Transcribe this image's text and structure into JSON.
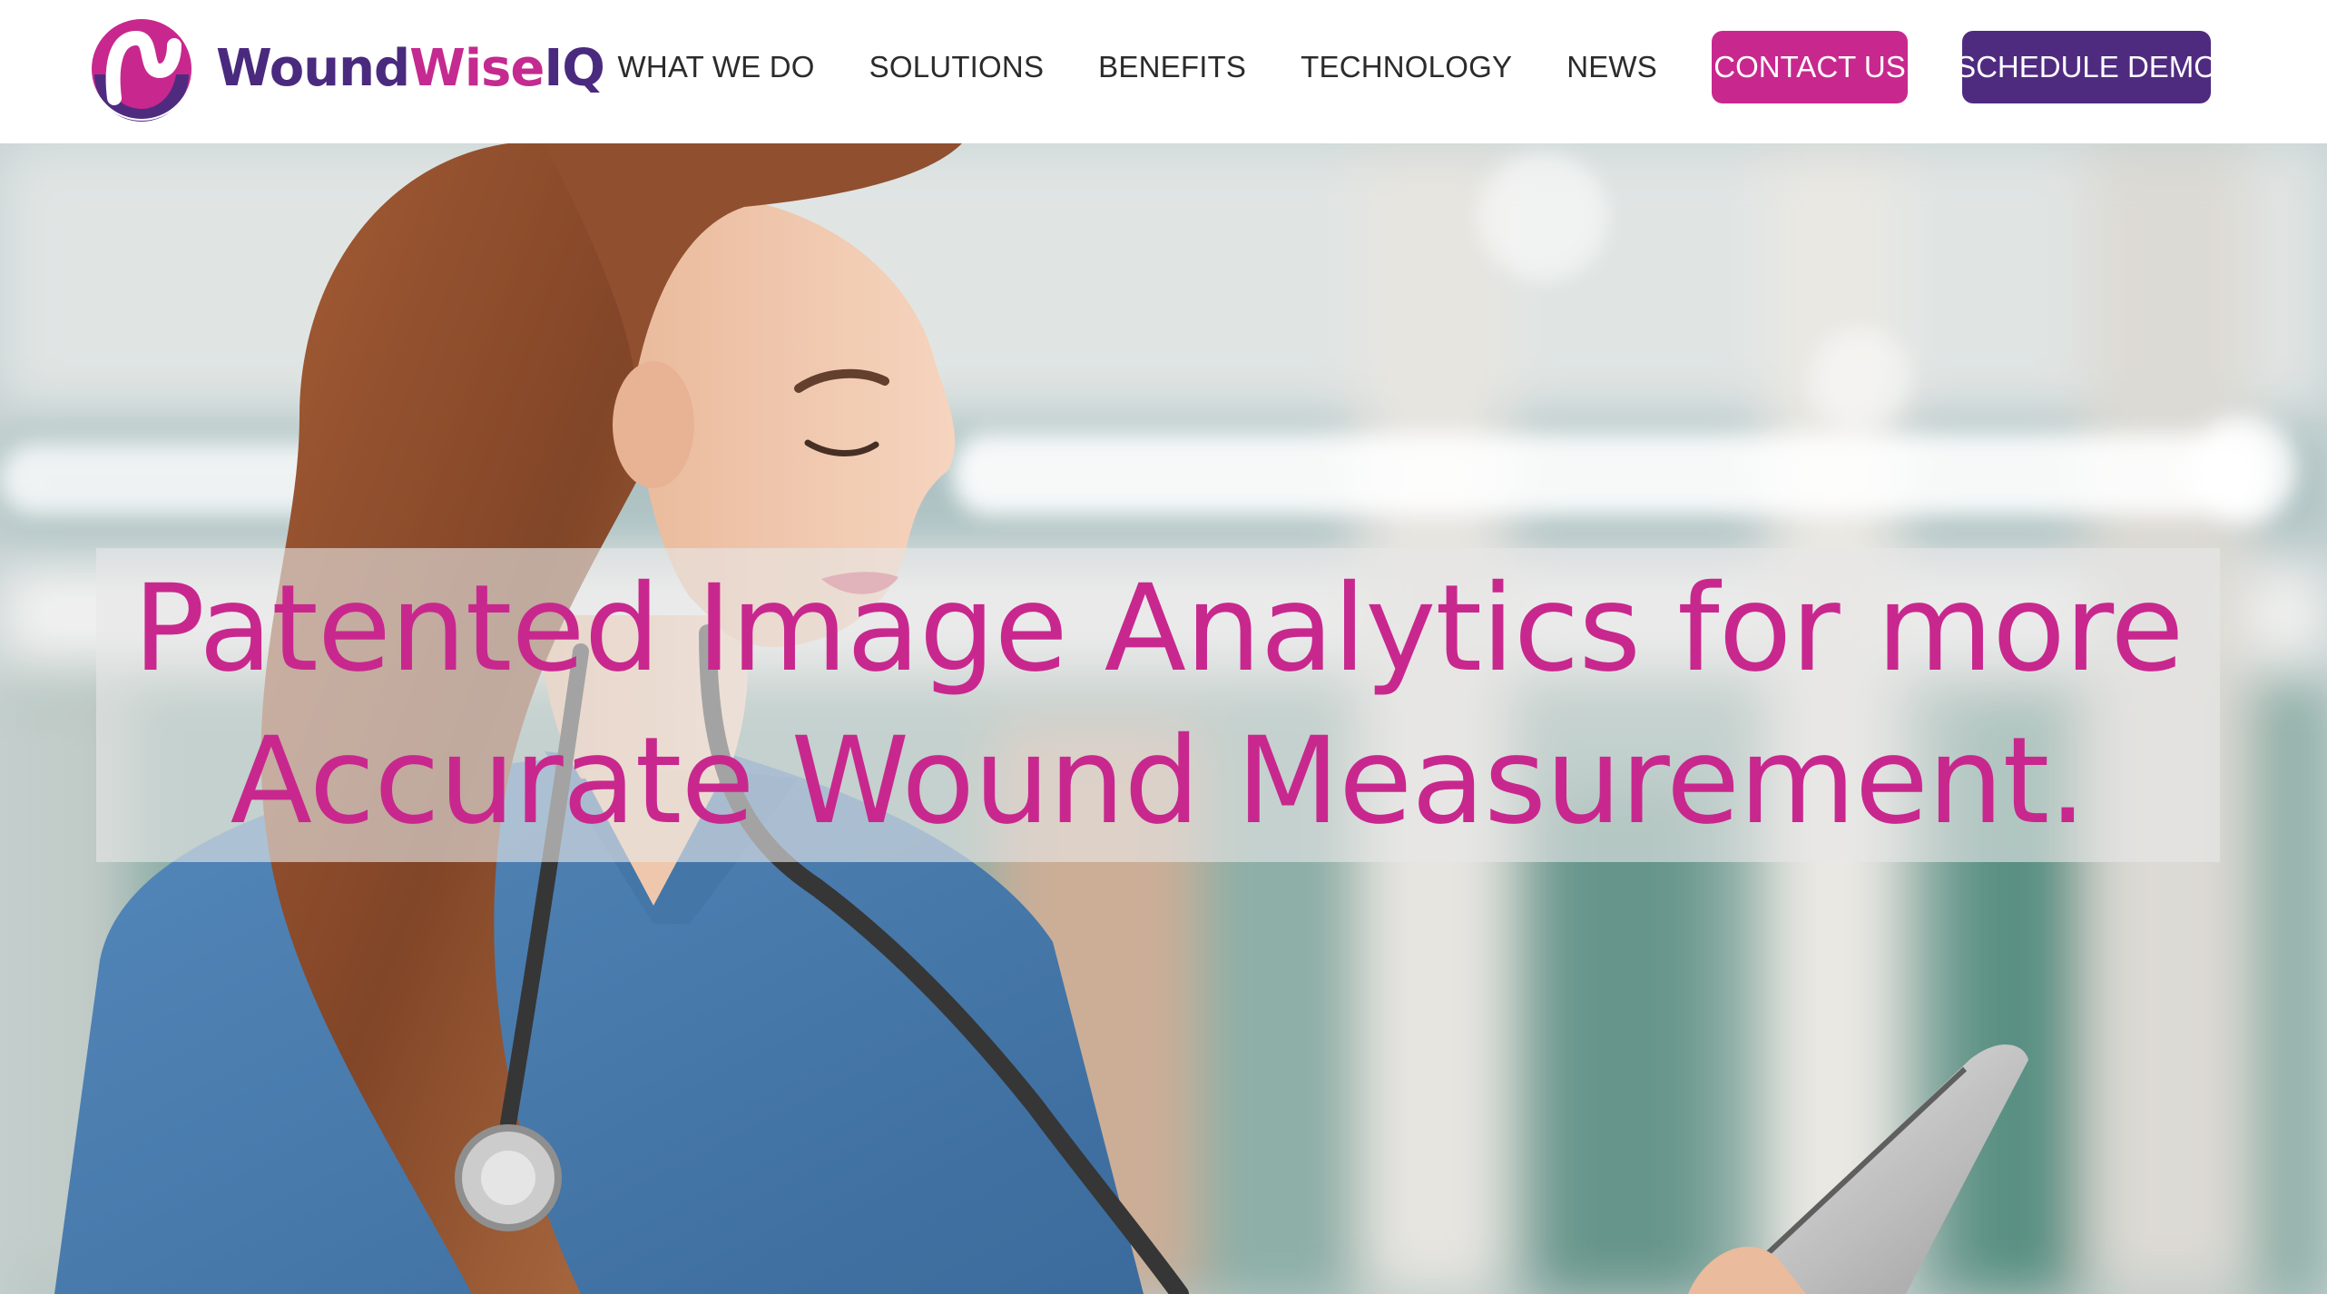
{
  "brand": {
    "name_part1": "Wound",
    "name_part2": "Wise",
    "name_part3": "IQ",
    "colors": {
      "purple": "#4f2b80",
      "magenta": "#c8288e"
    }
  },
  "nav": {
    "items": [
      {
        "label": "WHAT WE DO"
      },
      {
        "label": "SOLUTIONS"
      },
      {
        "label": "BENEFITS"
      },
      {
        "label": "TECHNOLOGY"
      },
      {
        "label": "NEWS"
      }
    ],
    "contact_label": "CONTACT US",
    "demo_label": "SCHEDULE DEMO"
  },
  "hero": {
    "headline_line1": "Patented Image Analytics for more",
    "headline_line2": "Accurate Wound Measurement.",
    "image": "nurse-with-stethoscope-holding-tablet"
  }
}
